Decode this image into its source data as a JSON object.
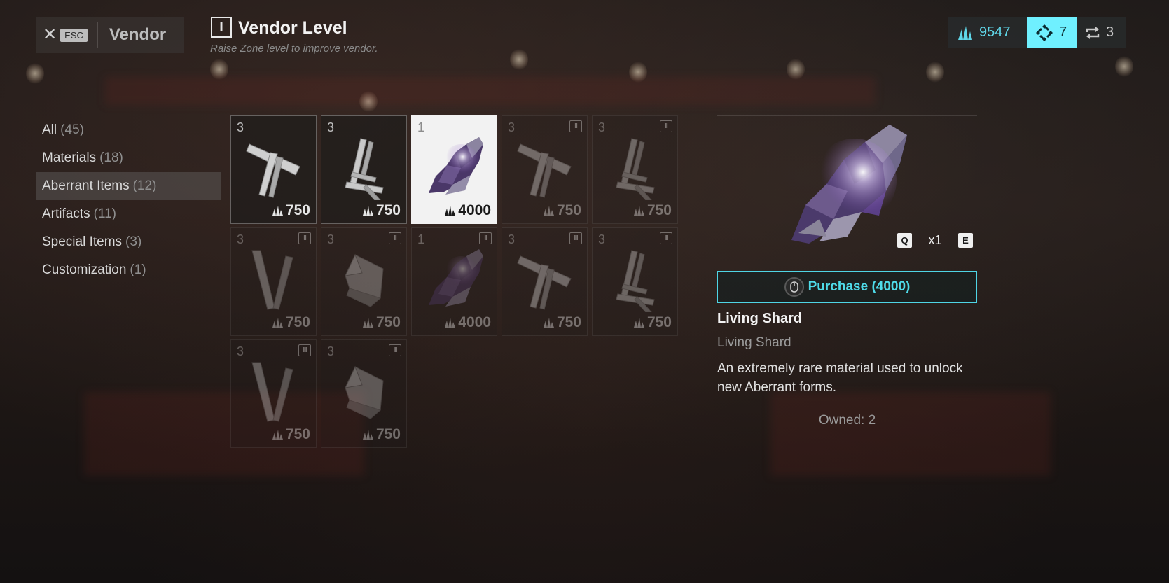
{
  "header": {
    "esc_key": "ESC",
    "vendor_title": "Vendor",
    "level_numeral": "I",
    "level_title": "Vendor Level",
    "level_subtitle": "Raise Zone level to improve vendor."
  },
  "currencies": {
    "shards": "9547",
    "cores": "7",
    "rerolls": "3",
    "accent": "#6ff0ff"
  },
  "categories": [
    {
      "label": "All",
      "count": "(45)"
    },
    {
      "label": "Materials",
      "count": "(18)"
    },
    {
      "label": "Aberrant Items",
      "count": "(12)",
      "active": true
    },
    {
      "label": "Artifacts",
      "count": "(11)"
    },
    {
      "label": "Special Items",
      "count": "(3)"
    },
    {
      "label": "Customization",
      "count": "(1)"
    }
  ],
  "items": [
    {
      "qty": "3",
      "tier": "",
      "price": "750",
      "art": "cross-bars"
    },
    {
      "qty": "3",
      "tier": "",
      "price": "750",
      "art": "scaffold"
    },
    {
      "qty": "1",
      "tier": "",
      "price": "4000",
      "art": "living-shard",
      "selected": true
    },
    {
      "qty": "3",
      "tier": "II",
      "price": "750",
      "art": "cross-bars"
    },
    {
      "qty": "3",
      "tier": "II",
      "price": "750",
      "art": "scaffold"
    },
    {
      "qty": "3",
      "tier": "II",
      "price": "750",
      "art": "v-bars"
    },
    {
      "qty": "3",
      "tier": "II",
      "price": "750",
      "art": "plate"
    },
    {
      "qty": "1",
      "tier": "II",
      "price": "4000",
      "art": "living-shard"
    },
    {
      "qty": "3",
      "tier": "III",
      "price": "750",
      "art": "cross-bars"
    },
    {
      "qty": "3",
      "tier": "III",
      "price": "750",
      "art": "scaffold"
    },
    {
      "qty": "3",
      "tier": "III",
      "price": "750",
      "art": "v-bars"
    },
    {
      "qty": "3",
      "tier": "III",
      "price": "750",
      "art": "plate"
    }
  ],
  "detail": {
    "quantity": "x1",
    "decrease_key": "Q",
    "increase_key": "E",
    "purchase_label": "Purchase (4000)",
    "name": "Living Shard",
    "type": "Living Shard",
    "description": "An extremely rare material used to unlock new Aberrant forms.",
    "owned": "Owned: 2"
  }
}
